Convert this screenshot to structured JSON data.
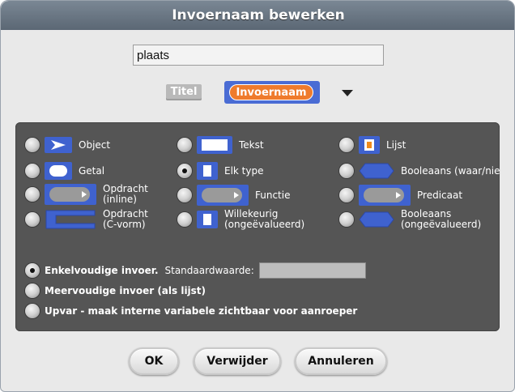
{
  "dialog": {
    "title": "Invoernaam bewerken",
    "name_value": "plaats"
  },
  "header_blocks": {
    "title_block": "Titel",
    "input_block": "Invoernaam"
  },
  "types": {
    "object": "Object",
    "text": "Tekst",
    "list": "Lijst",
    "number": "Getal",
    "any": "Elk type",
    "boolean": "Booleaans (waar/niet waar)",
    "command_inline_1": "Opdracht",
    "command_inline_2": "(inline)",
    "reporter": "Functie",
    "predicate": "Predicaat",
    "command_c_1": "Opdracht",
    "command_c_2": "(C-vorm)",
    "any_unevaluated_1": "Willekeurig",
    "any_unevaluated_2": "(ongeëvalueerd)",
    "boolean_unevaluated_1": "Booleaans",
    "boolean_unevaluated_2": "(ongeëvalueerd)"
  },
  "selected_type": "Elk type",
  "input_modes": {
    "single": "Enkelvoudige invoer.",
    "default_label": "Standaardwaarde:",
    "default_value": "",
    "multiple": "Meervoudige invoer (als lijst)",
    "upvar": "Upvar - maak interne variabele zichtbaar voor aanroeper"
  },
  "selected_mode": "Enkelvoudige invoer.",
  "buttons": {
    "ok": "OK",
    "delete": "Verwijder",
    "cancel": "Annuleren"
  },
  "colors": {
    "titlebar": "#6b7784",
    "panel": "#555555",
    "block_blue": "#3f62cf",
    "input_orange": "#ef7b2c",
    "title_block_gray": "#b9b9b9"
  }
}
